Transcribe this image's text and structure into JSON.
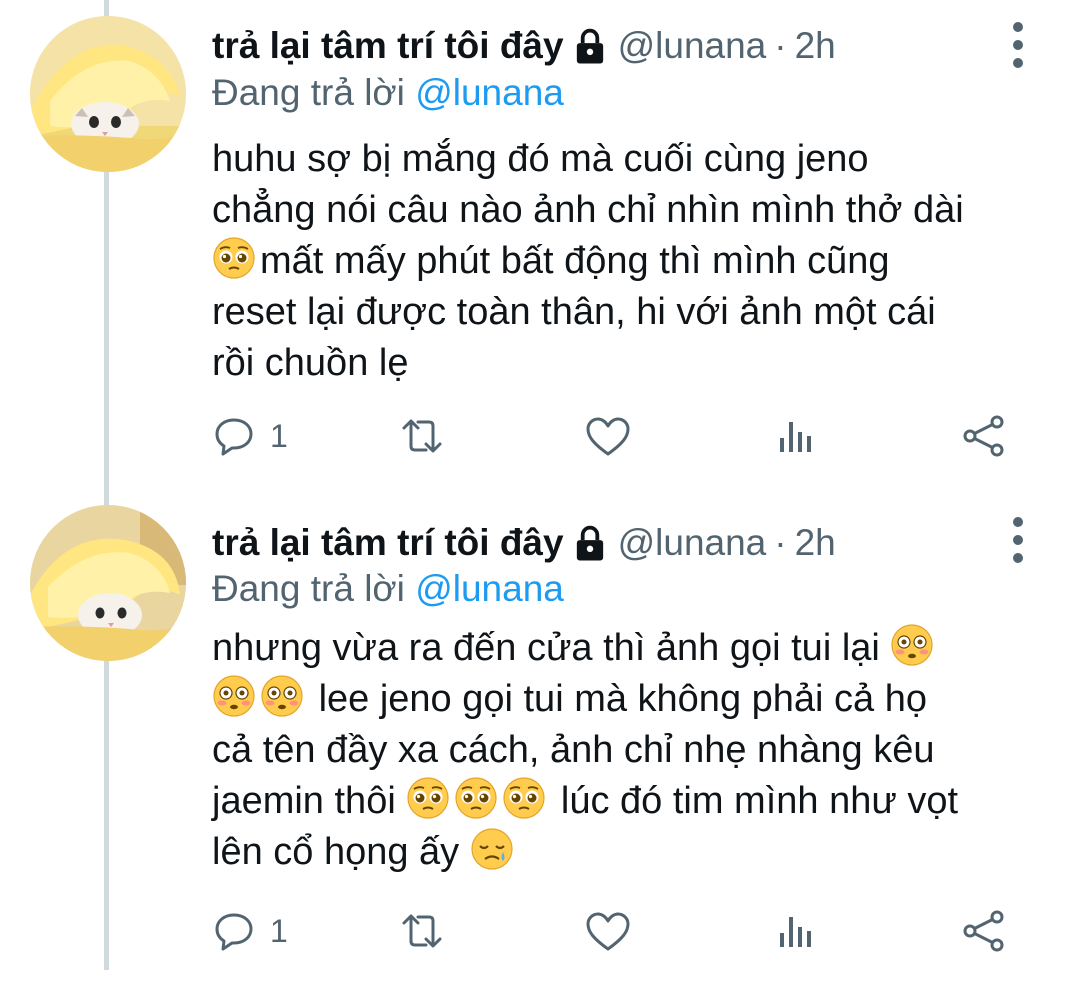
{
  "tweets": [
    {
      "author_name": "trả lại tâm trí tôi đây",
      "handle": "@lunana",
      "separator": "·",
      "time": "2h",
      "replying_prefix": "Đang trả lời",
      "replying_to": "@lunana",
      "body_lines": [
        "huhu sợ bị mắng đó mà cuối cùng jeno",
        "chẳng nói câu nào ảnh chỉ nhìn mình thở dài",
        "mất mấy phút bất động thì mình cũng",
        "reset lại được toàn thân, hi với ảnh một cái",
        "rồi chuồn lẹ"
      ],
      "reply_count": "1"
    },
    {
      "author_name": "trả lại tâm trí tôi đây",
      "handle": "@lunana",
      "separator": "·",
      "time": "2h",
      "replying_prefix": "Đang trả lời",
      "replying_to": "@lunana",
      "body_lines": [
        "nhưng vừa ra đến cửa thì ảnh gọi tui lại",
        "lee jeno gọi tui mà không phải cả họ",
        "cả tên đầy xa cách, ảnh chỉ nhẹ nhàng kêu",
        "jaemin thôi",
        "lúc đó tim mình như vọt",
        "lên cổ họng ấy"
      ],
      "reply_count": "1"
    }
  ],
  "icons": {
    "lock": "lock-icon",
    "more": "more-vertical-icon",
    "reply": "reply-icon",
    "retweet": "retweet-icon",
    "like": "heart-icon",
    "stats": "analytics-icon",
    "share": "share-icon",
    "emoji_pleading": "pleading-face-emoji",
    "emoji_flushed": "flushed-face-emoji",
    "emoji_crying": "crying-face-emoji"
  },
  "colors": {
    "text": "#0f1419",
    "secondary": "#536471",
    "link": "#1d9bf0",
    "thread_line": "#cfd9de"
  }
}
